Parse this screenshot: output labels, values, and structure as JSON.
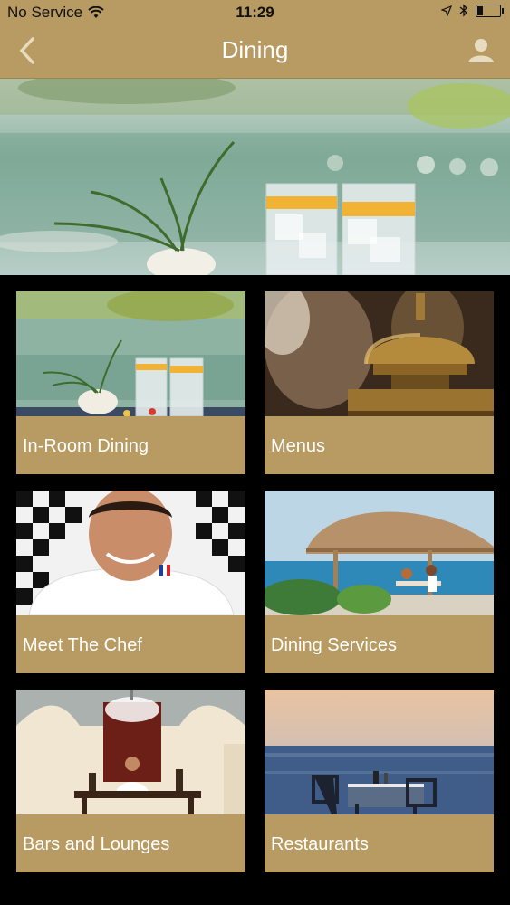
{
  "status": {
    "carrier": "No Service",
    "time": "11:29",
    "battery_level": 0.25
  },
  "nav": {
    "title": "Dining",
    "back_icon": "chevron-left-icon",
    "profile_icon": "user-icon"
  },
  "colors": {
    "gold": "#b79b62",
    "background": "#000000",
    "label_text": "#ffffff"
  },
  "tiles": [
    {
      "label": "In-Room Dining",
      "icon": "in-room-dining-image"
    },
    {
      "label": "Menus",
      "icon": "service-bell-image"
    },
    {
      "label": "Meet The Chef",
      "icon": "chef-portrait-image"
    },
    {
      "label": "Dining Services",
      "icon": "beach-cabana-image"
    },
    {
      "label": "Bars and Lounges",
      "icon": "bartender-image"
    },
    {
      "label": "Restaurants",
      "icon": "seaside-table-image"
    }
  ]
}
